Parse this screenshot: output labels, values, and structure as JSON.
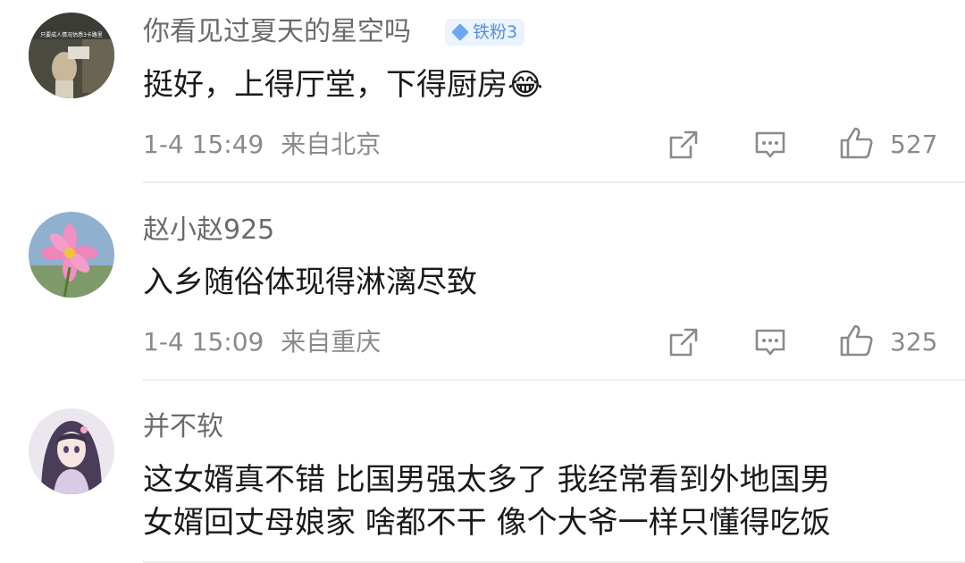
{
  "comments": [
    {
      "username": "你看见过夏天的星空吗",
      "badge": "铁粉3",
      "text_lines": [
        "挺好，上得厅堂，下得厨房"
      ],
      "emoji": "😂",
      "timestamp": "1-4 15:49",
      "location": "来自北京",
      "likes": "527",
      "avatar_caption": "只要成人情况估悉3卡路里"
    },
    {
      "username": "赵小赵925",
      "text_lines": [
        "入乡随俗体现得淋漓尽致"
      ],
      "timestamp": "1-4 15:09",
      "location": "来自重庆",
      "likes": "325"
    },
    {
      "username": "并不软",
      "text_lines": [
        "这女婿真不错 比国男强太多了 我经常看到外地国男",
        "女婿回丈母娘家 啥都不干 像个大爷一样只懂得吃饭"
      ]
    }
  ],
  "icons": {
    "share": "share-icon",
    "reply": "comment-icon",
    "like": "thumbs-up-icon"
  },
  "colors": {
    "badge_bg": "#eaf3fe",
    "badge_text": "#5a8fd8",
    "username": "#6b6b6b",
    "meta": "#8a8a8a",
    "divider": "#ececec"
  }
}
